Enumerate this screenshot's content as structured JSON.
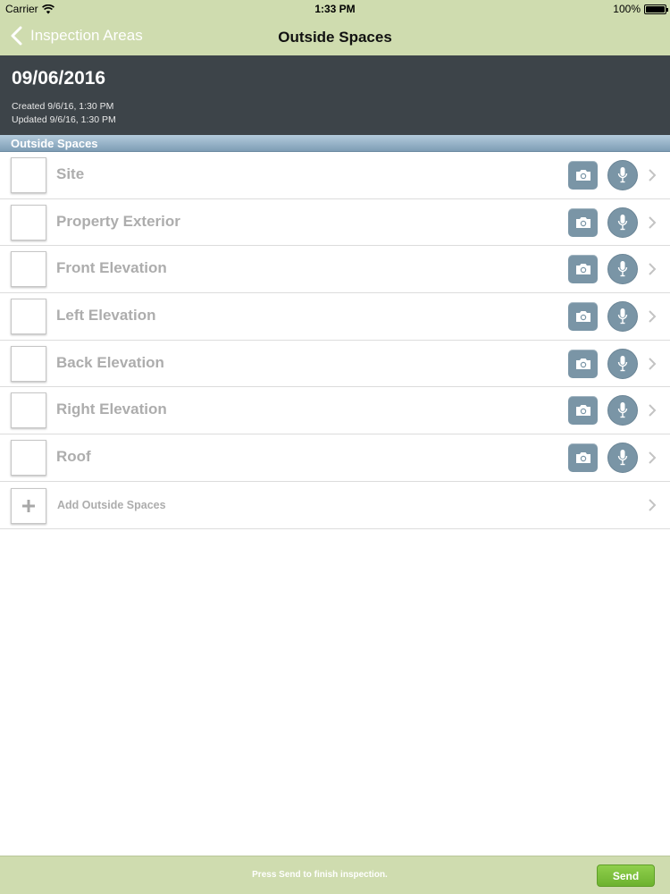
{
  "status_bar": {
    "carrier": "Carrier",
    "time": "1:33 PM",
    "battery": "100%",
    "battery_level": 1.0
  },
  "nav": {
    "back_label": "Inspection Areas",
    "title": "Outside Spaces"
  },
  "header": {
    "date": "09/06/2016",
    "created": "Created 9/6/16, 1:30 PM",
    "updated": "Updated 9/6/16, 1:30 PM"
  },
  "section": {
    "title": "Outside Spaces"
  },
  "items": [
    {
      "label": "Site"
    },
    {
      "label": "Property Exterior"
    },
    {
      "label": "Front Elevation"
    },
    {
      "label": "Left Elevation"
    },
    {
      "label": "Back Elevation"
    },
    {
      "label": "Right Elevation"
    },
    {
      "label": "Roof"
    }
  ],
  "add_row": {
    "label": "Add Outside Spaces"
  },
  "footer": {
    "message": "Press Send to finish inspection.",
    "send_label": "Send"
  },
  "colors": {
    "bar_green": "#cfdcaf",
    "header_dark": "#3d4449",
    "button_blue_gray": "#7a95a6",
    "send_green": "#7cc03c",
    "label_gray": "#adadad"
  },
  "icons": {
    "back": "chevron-left-icon",
    "camera": "camera-icon",
    "microphone": "microphone-icon",
    "disclosure": "chevron-right-icon",
    "add": "plus-icon",
    "wifi": "wifi-icon",
    "battery": "battery-icon"
  }
}
